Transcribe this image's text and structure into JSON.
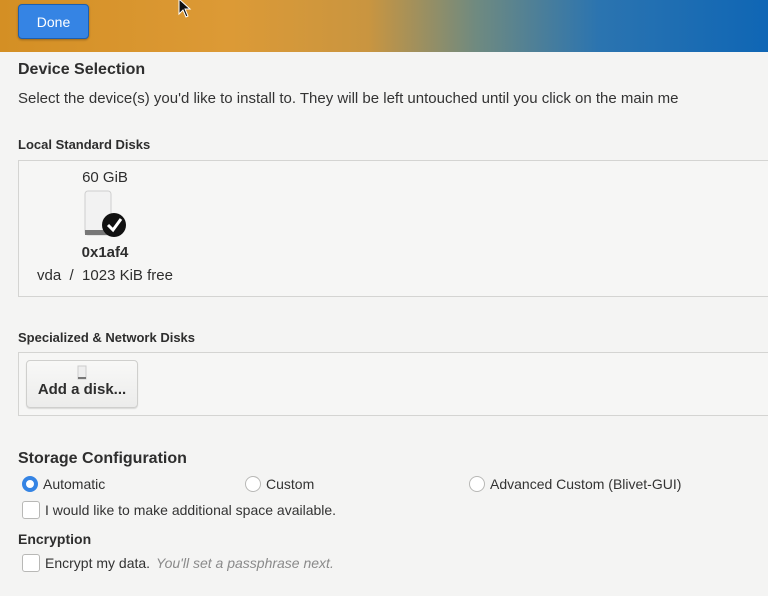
{
  "header": {
    "done_label": "Done"
  },
  "device_selection": {
    "title": "Device Selection",
    "description": "Select the device(s) you'd like to install to.  They will be left untouched until you click on the main me"
  },
  "local_disks": {
    "label": "Local Standard Disks",
    "disks": [
      {
        "size": "60 GiB",
        "name": "0x1af4",
        "details": "vda  /  1023 KiB free",
        "selected": true
      }
    ]
  },
  "network_disks": {
    "label": "Specialized & Network Disks",
    "add_label": "Add a disk..."
  },
  "storage_config": {
    "title": "Storage Configuration",
    "options": [
      {
        "label": "Automatic",
        "selected": true
      },
      {
        "label": "Custom",
        "selected": false
      },
      {
        "label": "Advanced Custom (Blivet-GUI)",
        "selected": false
      }
    ],
    "additional_space": {
      "label": "I would like to make additional space available.",
      "checked": false
    }
  },
  "encryption": {
    "title": "Encryption",
    "encrypt_label": "Encrypt my data.",
    "encrypt_hint": "You'll set a passphrase next.",
    "checked": false
  },
  "colors": {
    "accent": "#3584e4"
  }
}
